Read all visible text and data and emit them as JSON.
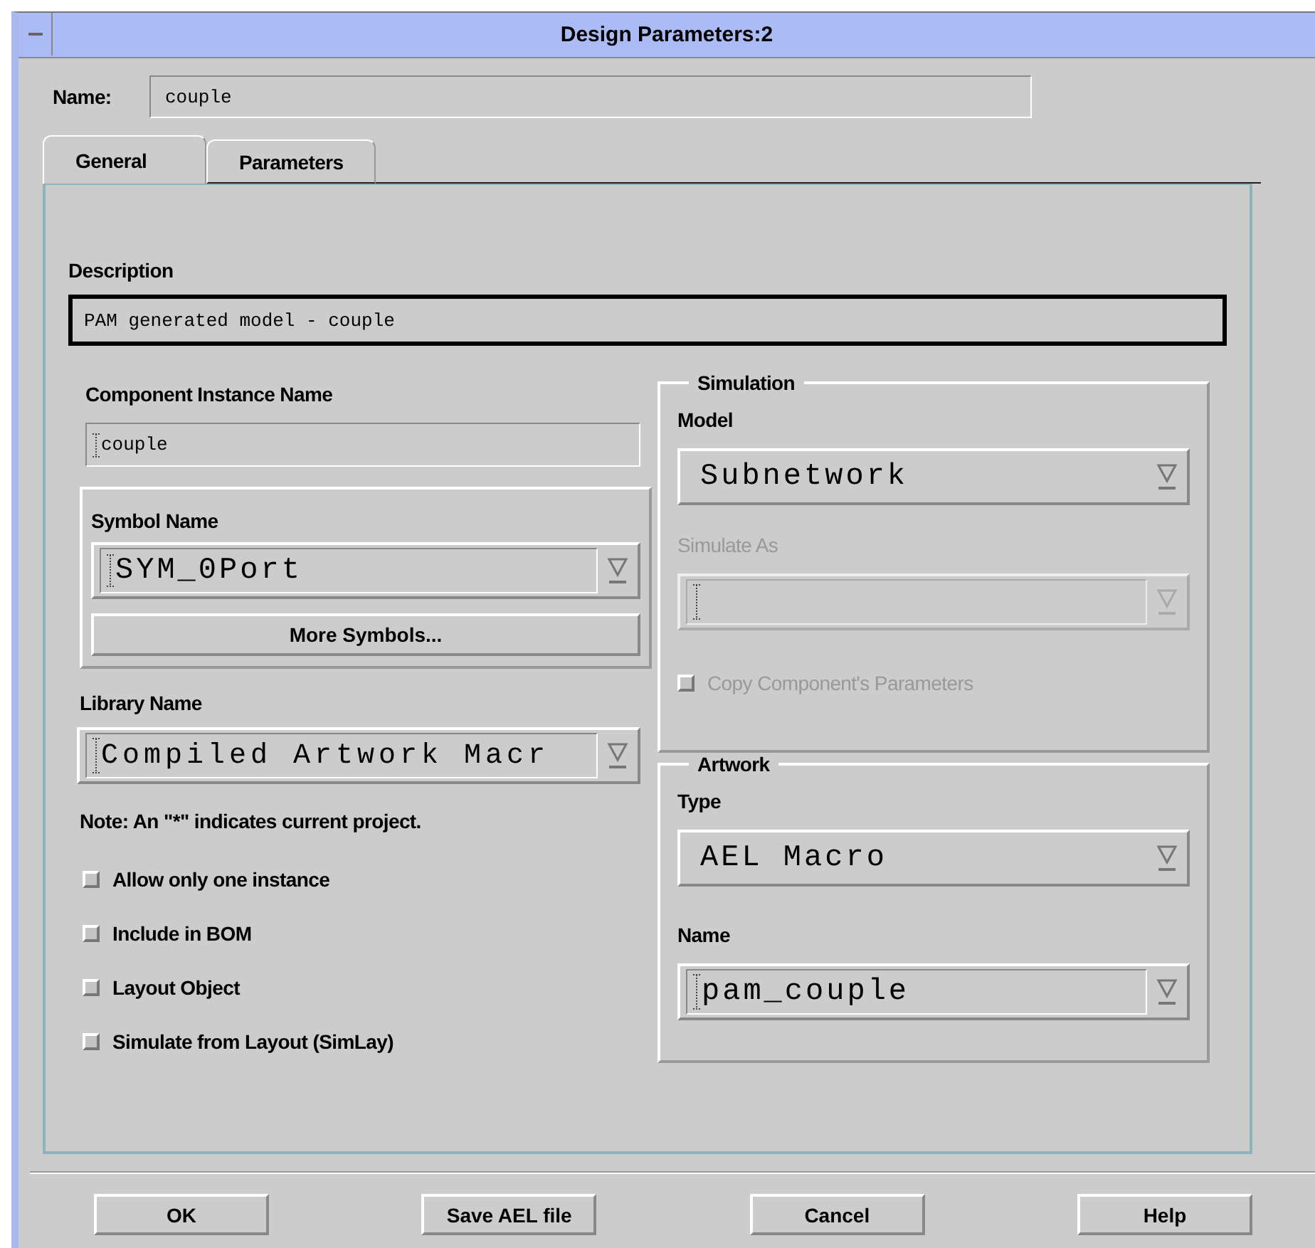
{
  "window": {
    "title": "Design Parameters:2"
  },
  "name_field": {
    "label": "Name:",
    "value": "couple"
  },
  "tabs": [
    {
      "label": "General",
      "selected": true
    },
    {
      "label": "Parameters",
      "selected": false
    }
  ],
  "description": {
    "label": "Description",
    "value": "PAM generated model - couple"
  },
  "instance_name": {
    "label": "Component Instance Name",
    "value": "couple"
  },
  "symbol": {
    "label": "Symbol Name",
    "dropdown": {
      "kind": "editable",
      "value": "SYM_0Port",
      "disabled": false
    },
    "button": "More Symbols..."
  },
  "library": {
    "label": "Library Name",
    "dropdown": {
      "kind": "editable",
      "value": "Compiled Artwork Macr",
      "disabled": false
    }
  },
  "note": "Note: An \"*\" indicates current project.",
  "options": [
    {
      "label": "Allow only one instance",
      "checked": false
    },
    {
      "label": "Include in BOM",
      "checked": false
    },
    {
      "label": "Layout Object",
      "checked": false
    },
    {
      "label": "Simulate from Layout (SimLay)",
      "checked": false
    }
  ],
  "simulation": {
    "title": "Simulation",
    "model_label": "Model",
    "model": {
      "kind": "option",
      "value": "Subnetwork",
      "disabled": false
    },
    "simulate_as_label": "Simulate As",
    "simulate_as": {
      "kind": "editable",
      "disabled": true
    },
    "copy_parameters": {
      "label": "Copy Component's Parameters",
      "checked": false,
      "disabled": true
    }
  },
  "artwork": {
    "title": "Artwork",
    "type_label": "Type",
    "type": {
      "kind": "option",
      "value": "AEL Macro",
      "disabled": false
    },
    "name_label": "Name",
    "name": {
      "kind": "editable",
      "value": "pam_couple",
      "disabled": false
    }
  },
  "buttons": [
    "OK",
    "Save AEL file",
    "Cancel",
    "Help"
  ]
}
